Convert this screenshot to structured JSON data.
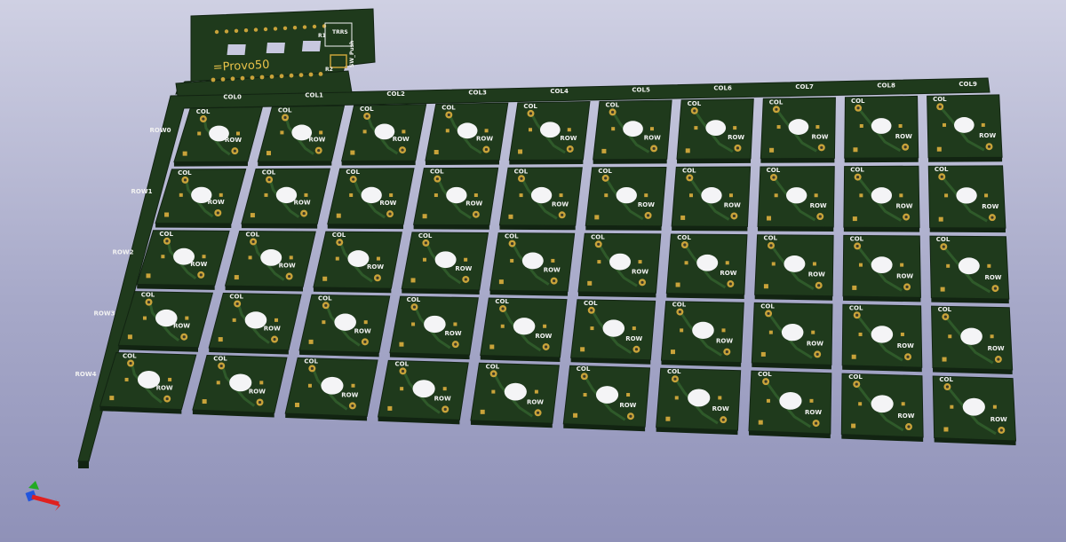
{
  "board": {
    "columns": [
      "COL0",
      "COL1",
      "COL2",
      "COL3",
      "COL4",
      "COL5",
      "COL6",
      "COL7",
      "COL8",
      "COL9"
    ],
    "rows": [
      "ROW0",
      "ROW1",
      "ROW2",
      "ROW3",
      "ROW4"
    ],
    "key_col_label": "COL",
    "key_row_label": "ROW",
    "controller": {
      "logo": "=Provo50",
      "labels": [
        "TRRS",
        "SW_Push",
        "R1",
        "R2"
      ]
    }
  },
  "colors": {
    "background_top": "#cfd0e3",
    "background_bottom": "#8f91b8",
    "pcb": "#1f3a1c",
    "pcb_edge": "#122412",
    "trace": "#2f5a2a",
    "pad": "#c9a33a",
    "silkscreen": "#f2f2f2"
  },
  "axis_icon": "xyz-axis-gizmo-icon"
}
